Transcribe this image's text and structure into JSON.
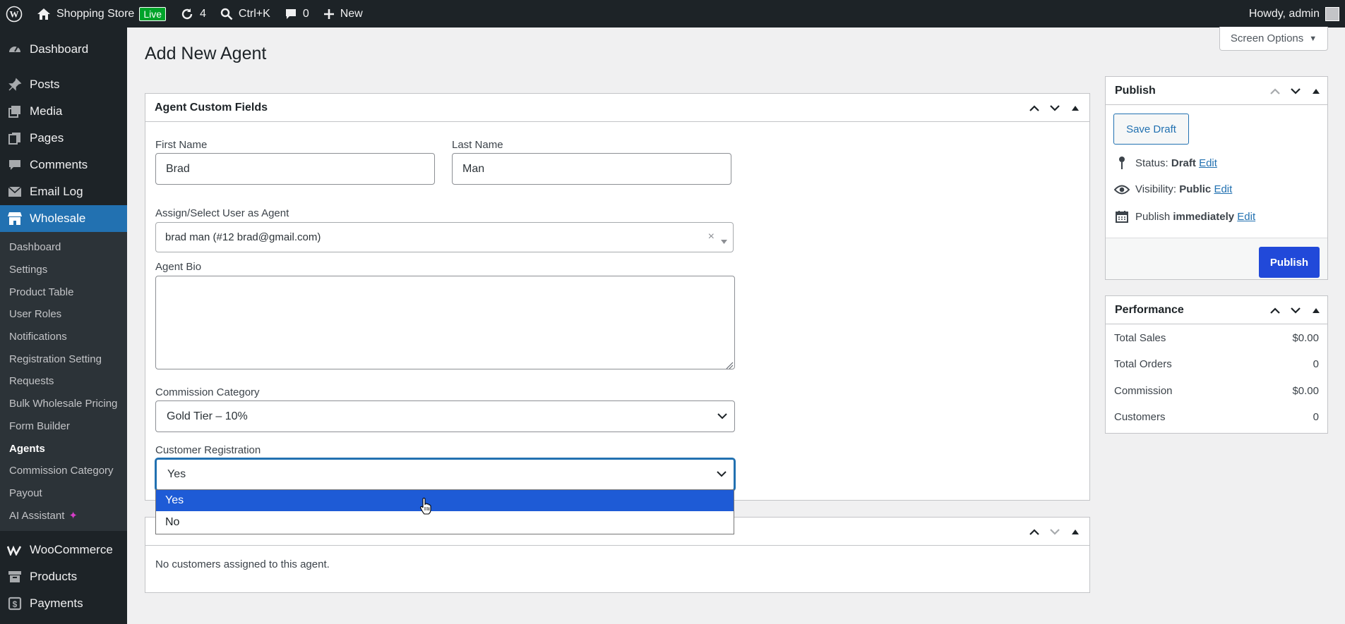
{
  "adminbar": {
    "site_name": "Shopping Store",
    "live_badge": "Live",
    "updates_count": "4",
    "search_shortcut": "Ctrl+K",
    "comments_count": "0",
    "new_label": "New",
    "howdy": "Howdy, admin"
  },
  "sidebar": {
    "top_items": [
      {
        "label": "Dashboard",
        "icon": "dashboard-icon"
      },
      {
        "label": "Posts",
        "icon": "pin-icon"
      },
      {
        "label": "Media",
        "icon": "media-icon"
      },
      {
        "label": "Pages",
        "icon": "pages-icon"
      },
      {
        "label": "Comments",
        "icon": "comment-icon"
      },
      {
        "label": "Email Log",
        "icon": "email-icon"
      }
    ],
    "current_item": {
      "label": "Wholesale",
      "icon": "store-icon"
    },
    "submenu": [
      "Dashboard",
      "Settings",
      "Product Table",
      "User Roles",
      "Notifications",
      "Registration Setting",
      "Requests",
      "Bulk Wholesale Pricing",
      "Form Builder",
      "Agents",
      "Commission Category",
      "Payout",
      "AI Assistant"
    ],
    "submenu_current": "Agents",
    "bottom_items": [
      {
        "label": "WooCommerce",
        "icon": "woo-icon"
      },
      {
        "label": "Products",
        "icon": "archive-icon"
      },
      {
        "label": "Payments",
        "icon": "payments-icon"
      }
    ]
  },
  "screen_options": "Screen Options",
  "page_title": "Add New Agent",
  "custom_fields": {
    "title": "Agent Custom Fields",
    "first_name_label": "First Name",
    "first_name_value": "Brad",
    "last_name_label": "Last Name",
    "last_name_value": "Man",
    "assign_user_label": "Assign/Select User as Agent",
    "assign_user_value": "brad man (#12 brad@gmail.com)",
    "clear_symbol": "×",
    "bio_label": "Agent Bio",
    "bio_value": "",
    "commission_label": "Commission Category",
    "commission_value": "Gold Tier – 10%",
    "registration_label": "Customer Registration",
    "registration_value": "Yes",
    "registration_options": [
      "Yes",
      "No"
    ],
    "registration_highlighted": "Yes"
  },
  "customers_box": {
    "title": "",
    "empty_text": "No customers assigned to this agent."
  },
  "publish": {
    "title": "Publish",
    "save_draft": "Save Draft",
    "status_label": "Status:",
    "status_value": "Draft",
    "visibility_label": "Visibility:",
    "visibility_value": "Public",
    "publish_label": "Publish",
    "publish_value": "immediately",
    "edit_label": "Edit",
    "publish_button": "Publish"
  },
  "performance": {
    "title": "Performance",
    "rows": [
      {
        "label": "Total Sales",
        "value": "$0.00"
      },
      {
        "label": "Total Orders",
        "value": "0"
      },
      {
        "label": "Commission",
        "value": "$0.00"
      },
      {
        "label": "Customers",
        "value": "0"
      }
    ]
  },
  "colors": {
    "admin_dark": "#1d2327",
    "accent": "#2271b1",
    "primary_button": "#2149d9",
    "live_green": "#00a32a",
    "dropdown_highlight": "#1e5bd6"
  }
}
